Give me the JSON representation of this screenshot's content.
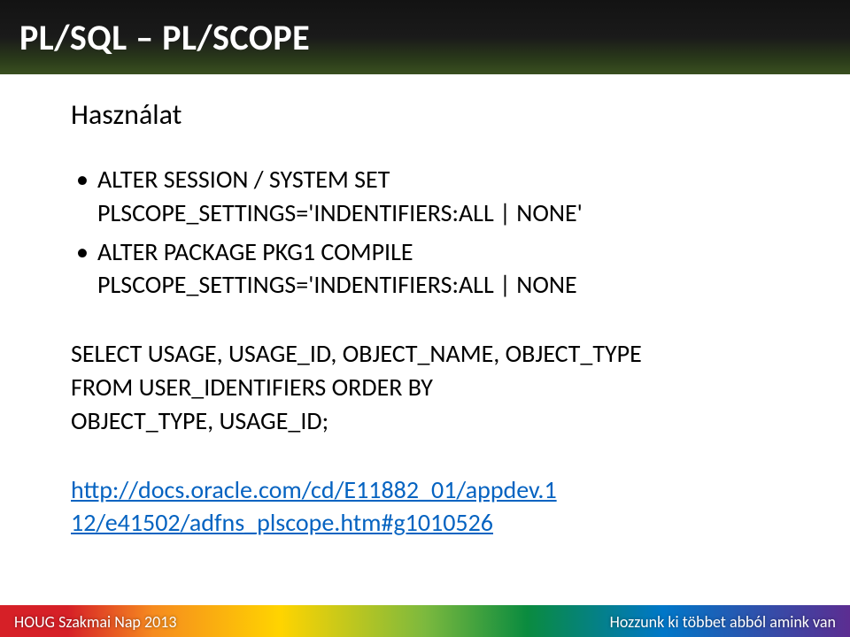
{
  "title": "PL/SQL – PL/SCOPE",
  "heading": "Használat",
  "bullet1_line1": "ALTER SESSION / SYSTEM SET",
  "bullet1_line2": "PLSCOPE_SETTINGS='INDENTIFIERS:ALL | NONE'",
  "bullet2_line1": "ALTER PACKAGE PKG1 COMPILE",
  "bullet2_line2": "PLSCOPE_SETTINGS='INDENTIFIERS:ALL | NONE",
  "code_line1": "SELECT USAGE, USAGE_ID, OBJECT_NAME, OBJECT_TYPE",
  "code_line2": "FROM USER_IDENTIFIERS ORDER BY",
  "code_line3": "OBJECT_TYPE, USAGE_ID;",
  "link_line1": "http://docs.oracle.com/cd/E11882_01/appdev.1",
  "link_line2": "12/e41502/adfns_plscope.htm#g1010526",
  "link_href": "http://docs.oracle.com/cd/E11882_01/appdev.112/e41502/adfns_plscope.htm#g1010526",
  "footer_left": "HOUG Szakmai Nap 2013",
  "footer_right": "Hozzunk ki többet abból amink van"
}
